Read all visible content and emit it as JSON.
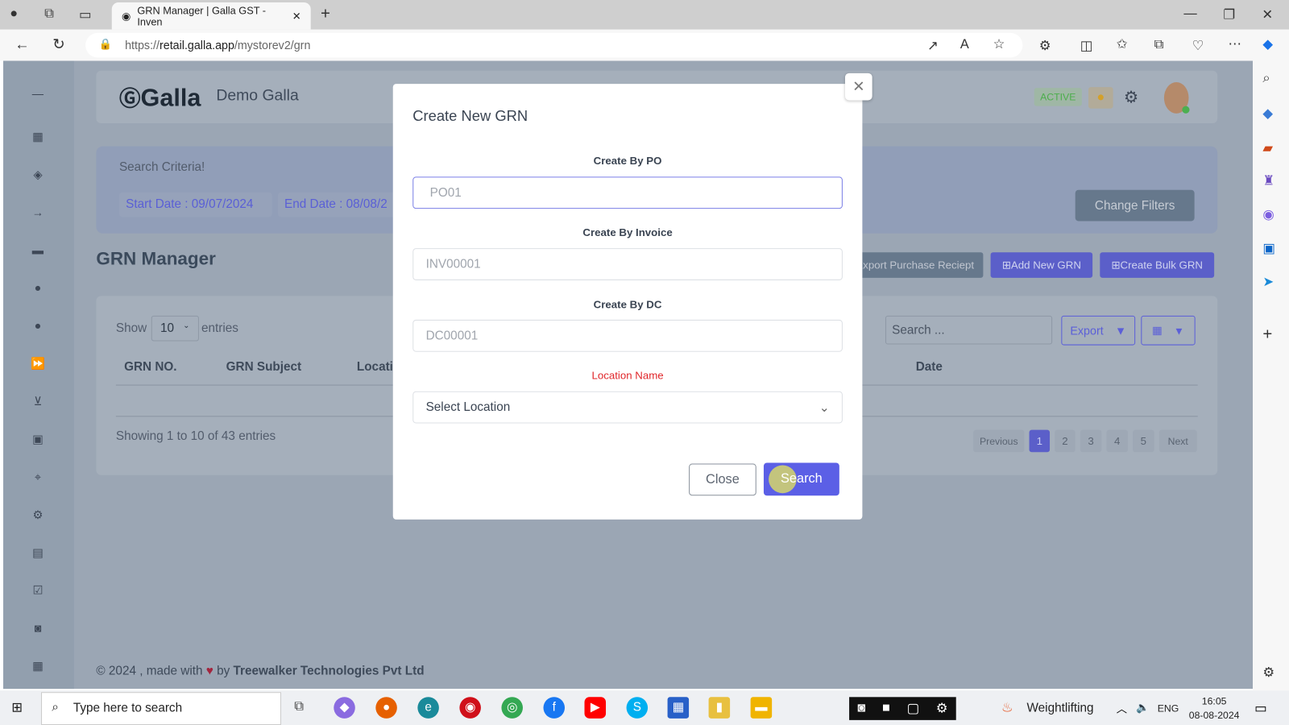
{
  "browser": {
    "tab_title": "GRN Manager | Galla GST - Inven",
    "url_host": "retail.galla.app",
    "url_prefix": "https://",
    "url_path": "/mystorev2/grn"
  },
  "header": {
    "brand": "Galla",
    "store": "Demo Galla",
    "status": "ACTIVE"
  },
  "criteria": {
    "title": "Search Criteria!",
    "start": "Start Date : 09/07/2024",
    "end": "End Date : 08/08/2",
    "change": "Change Filters"
  },
  "page": {
    "title": "GRN Manager",
    "export_receipt": "Export Purchase Reciept",
    "add_new": "Add New GRN",
    "bulk": "Create Bulk GRN"
  },
  "table": {
    "show": "Show",
    "entries_value": "10",
    "entries": "entries",
    "search_placeholder": "Search ...",
    "export": "Export",
    "columns": [
      "GRN NO.",
      "GRN Subject",
      "Locati",
      "Date"
    ],
    "info": "Showing 1 to 10 of 43 entries",
    "pagination": [
      "Previous",
      "1",
      "2",
      "3",
      "4",
      "5",
      "Next"
    ],
    "active_page": "1"
  },
  "footer": {
    "text": "© 2024 , made with",
    "by": "by",
    "company": "Treewalker Technologies Pvt Ltd"
  },
  "modal": {
    "title": "Create New GRN",
    "po_label": "Create By PO",
    "po_placeholder": "PO01",
    "inv_label": "Create By Invoice",
    "inv_placeholder": "INV00001",
    "dc_label": "Create By DC",
    "dc_placeholder": "DC00001",
    "loc_label": "Location Name",
    "loc_placeholder": "Select Location",
    "close": "Close",
    "search": "Search"
  },
  "taskbar": {
    "search": "Type here to search",
    "weather": "Weightlifting",
    "lang": "ENG",
    "time": "16:05",
    "date": "08-08-2024"
  },
  "colors": {
    "accent": "#5b5fd8",
    "required": "#e0262a",
    "active_badge": "#5cb85c"
  }
}
